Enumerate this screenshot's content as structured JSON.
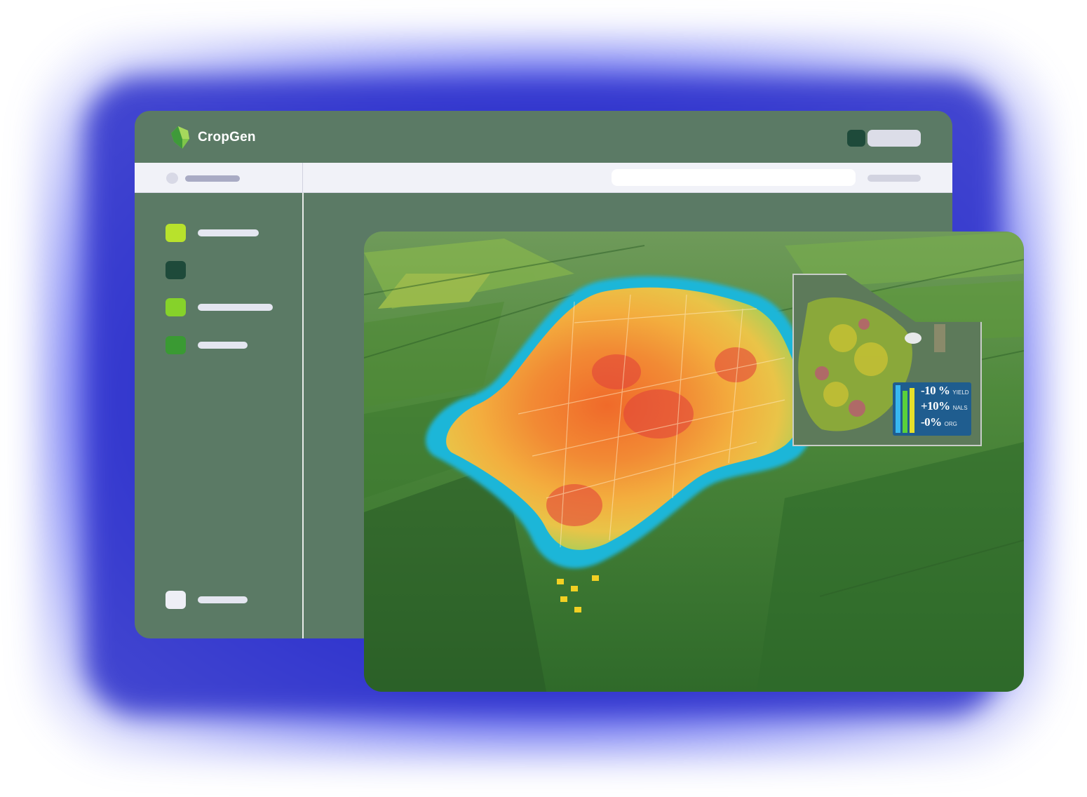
{
  "app": {
    "name": "CropGen"
  },
  "colors": {
    "window_bg": "#5b7a65",
    "subbar_bg": "#f1f2f8",
    "glow": "#2b2fc9",
    "nav_item_1": "#b8e22c",
    "nav_item_2": "#1e4a3a",
    "nav_item_3": "#86d22a",
    "nav_item_4": "#3a9a33",
    "nav_item_bottom": "#eeeff6"
  },
  "sidebar": {
    "items": [
      {
        "icon": "square-icon",
        "color": "#b8e22c"
      },
      {
        "icon": "square-icon",
        "color": "#1e4a3a"
      },
      {
        "icon": "square-icon",
        "color": "#86d22a"
      },
      {
        "icon": "square-icon",
        "color": "#3a9a33"
      }
    ],
    "bottom_item": {
      "icon": "square-icon",
      "color": "#eeeff6"
    }
  },
  "map": {
    "stats": [
      {
        "value": "-10 %",
        "label": "YIELD"
      },
      {
        "value": "+10%",
        "label": "NALS"
      },
      {
        "value": "-0%",
        "label": "ORG"
      }
    ]
  }
}
